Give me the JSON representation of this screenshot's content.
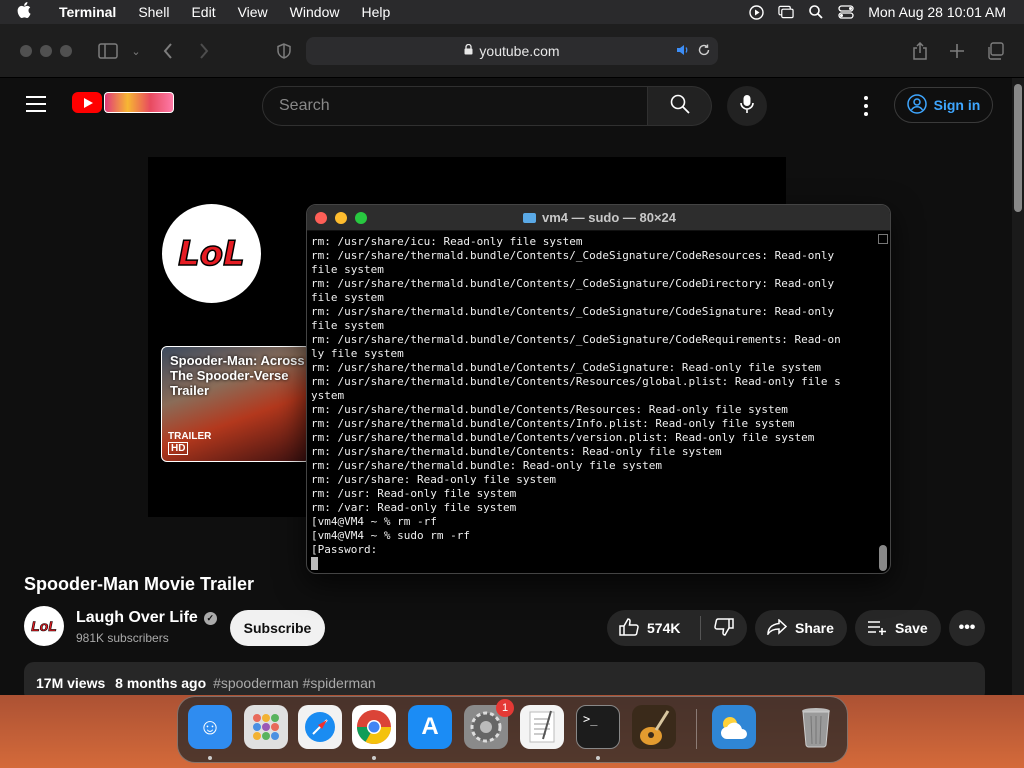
{
  "menubar": {
    "app_name": "Terminal",
    "items": [
      "Shell",
      "Edit",
      "View",
      "Window",
      "Help"
    ],
    "clock": "Mon Aug 28  10:01 AM"
  },
  "browser": {
    "url": "youtube.com"
  },
  "youtube": {
    "search_placeholder": "Search",
    "signin_label": "Sign in",
    "video_card_title": "Spooder-Man: Across The Spooder-Verse Trailer",
    "video_card_tag": "TRAILER",
    "video_card_hd": "HD",
    "logo_text": "LoL",
    "video_title": "Spooder-Man Movie Trailer",
    "channel_name": "Laugh Over Life",
    "channel_subs": "981K subscribers",
    "subscribe_label": "Subscribe",
    "likes": "574K",
    "share_label": "Share",
    "save_label": "Save",
    "views": "17M views",
    "uploaded": "8 months ago",
    "hashtags": "#spooderman #spiderman"
  },
  "terminal": {
    "title": "vm4 — sudo — 80×24",
    "lines": [
      "rm: /usr/share/icu: Read-only file system",
      "rm: /usr/share/thermald.bundle/Contents/_CodeSignature/CodeResources: Read-only",
      "file system",
      "rm: /usr/share/thermald.bundle/Contents/_CodeSignature/CodeDirectory: Read-only",
      "file system",
      "rm: /usr/share/thermald.bundle/Contents/_CodeSignature/CodeSignature: Read-only",
      "file system",
      "rm: /usr/share/thermald.bundle/Contents/_CodeSignature/CodeRequirements: Read-on",
      "ly file system",
      "rm: /usr/share/thermald.bundle/Contents/_CodeSignature: Read-only file system",
      "rm: /usr/share/thermald.bundle/Contents/Resources/global.plist: Read-only file s",
      "ystem",
      "rm: /usr/share/thermald.bundle/Contents/Resources: Read-only file system",
      "rm: /usr/share/thermald.bundle/Contents/Info.plist: Read-only file system",
      "rm: /usr/share/thermald.bundle/Contents/version.plist: Read-only file system",
      "rm: /usr/share/thermald.bundle/Contents: Read-only file system",
      "rm: /usr/share/thermald.bundle: Read-only file system",
      "rm: /usr/share: Read-only file system",
      "rm: /usr: Read-only file system",
      "rm: /var: Read-only file system",
      "[vm4@VM4 ~ % rm -rf",
      "[vm4@VM4 ~ % sudo rm -rf",
      "[Password:"
    ]
  },
  "dock": {
    "apps": [
      {
        "name": "Finder",
        "color": "#2f8cf0",
        "icon": "finder-icon"
      },
      {
        "name": "Launchpad",
        "color": "#e0e0e0",
        "icon": "launchpad-icon"
      },
      {
        "name": "Safari",
        "color": "#f2f2f2",
        "icon": "safari-icon"
      },
      {
        "name": "Chrome",
        "color": "#ffffff",
        "icon": "chrome-icon"
      },
      {
        "name": "App Store",
        "color": "#1b8cf5",
        "icon": "app-store-icon"
      },
      {
        "name": "System Settings",
        "color": "#8a8a8a",
        "icon": "settings-icon",
        "badge": "1"
      },
      {
        "name": "TextEdit",
        "color": "#f4f4f4",
        "icon": "textedit-icon"
      },
      {
        "name": "Terminal",
        "color": "#1c1c1c",
        "icon": "terminal-icon"
      },
      {
        "name": "GarageBand",
        "color": "#3a2a1a",
        "icon": "garageband-icon"
      },
      {
        "name": "Weather",
        "color": "#2f86d6",
        "icon": "weather-icon"
      },
      {
        "name": "Trash",
        "color": "#5a5a5a",
        "icon": "trash-icon"
      }
    ]
  }
}
